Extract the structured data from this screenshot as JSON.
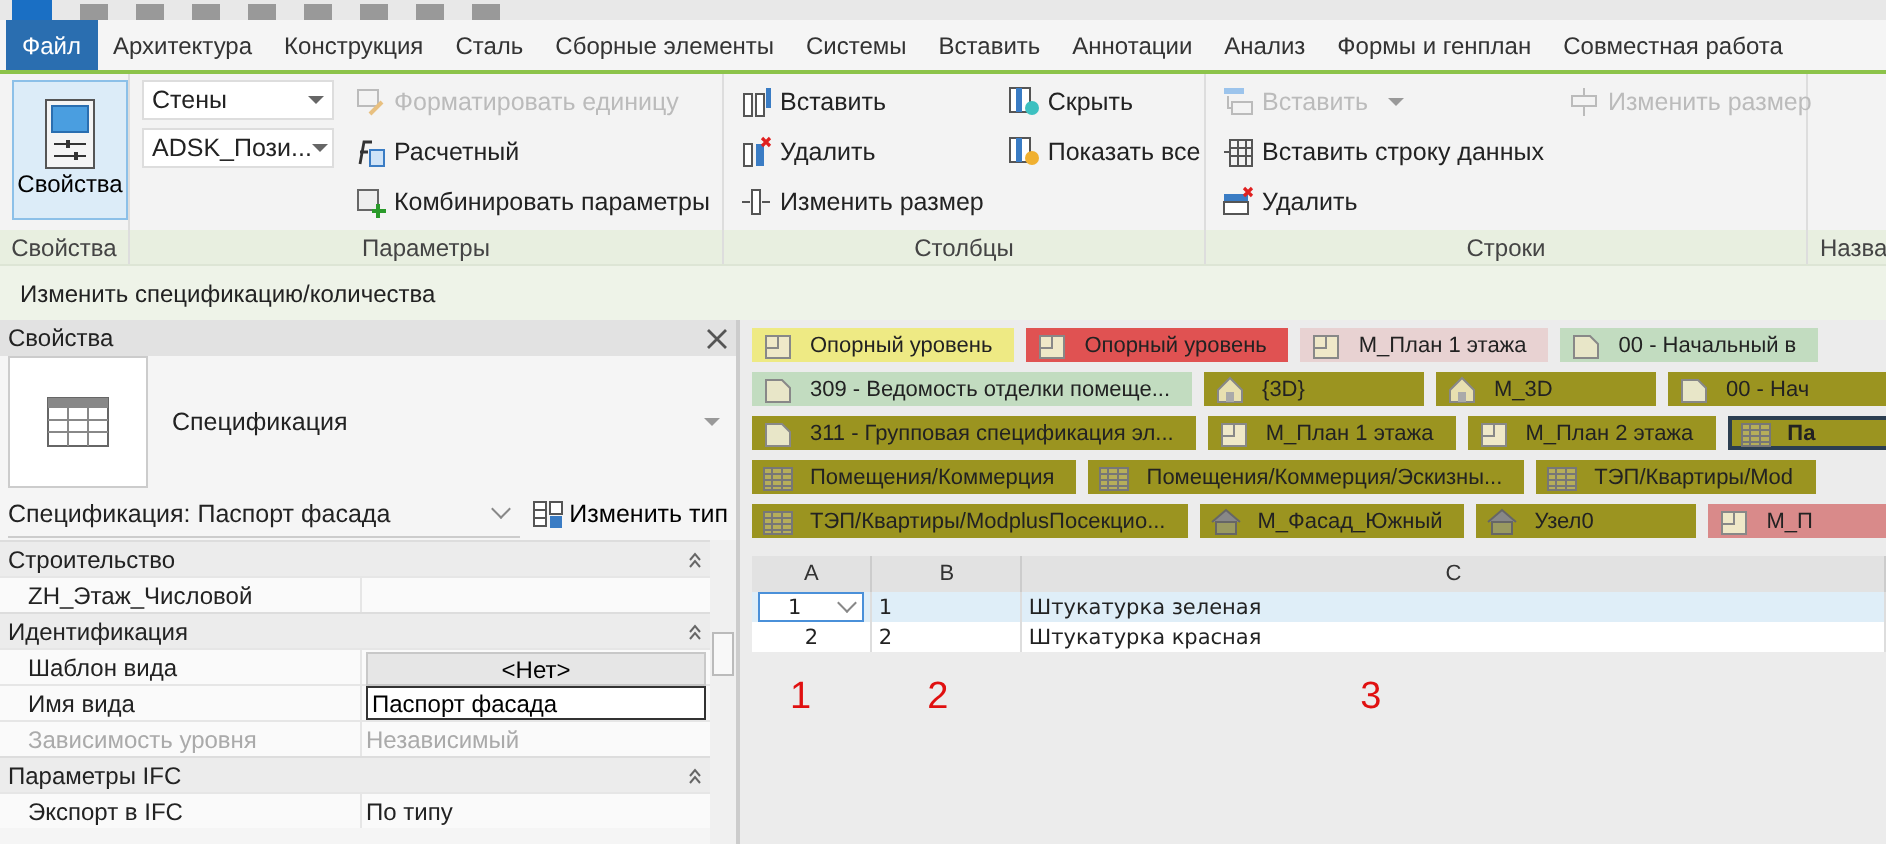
{
  "menu_tabs": [
    {
      "label": "Файл",
      "kind": "app-menu"
    },
    {
      "label": "Архитектура",
      "kind": "tab"
    },
    {
      "label": "Конструкция",
      "kind": "tab"
    },
    {
      "label": "Сталь",
      "kind": "tab"
    },
    {
      "label": "Сборные элементы",
      "kind": "tab"
    },
    {
      "label": "Системы",
      "kind": "tab"
    },
    {
      "label": "Вставить",
      "kind": "tab"
    },
    {
      "label": "Аннотации",
      "kind": "tab"
    },
    {
      "label": "Анализ",
      "kind": "tab"
    },
    {
      "label": "Формы и генплан",
      "kind": "tab"
    },
    {
      "label": "Совместная работа",
      "kind": "tab"
    }
  ],
  "ribbon": {
    "panels": [
      {
        "title": "Свойства",
        "kind": "large",
        "button": {
          "label": "Свойства",
          "selected": true
        }
      },
      {
        "title": "Параметры",
        "kind": "columns",
        "columns": [
          [
            {
              "kind": "dropdown",
              "value": "Стены"
            },
            {
              "kind": "dropdown",
              "value": "ADSK_Пози..."
            }
          ],
          [
            {
              "kind": "button",
              "label": "Форматировать единицу",
              "disabled": true
            },
            {
              "kind": "button",
              "label": "Расчетный",
              "disabled": false
            },
            {
              "kind": "button",
              "label": "Комбинировать параметры",
              "disabled": false
            }
          ]
        ]
      },
      {
        "title": "Столбцы",
        "kind": "columns",
        "columns": [
          [
            {
              "kind": "button",
              "label": "Вставить",
              "disabled": false
            },
            {
              "kind": "button",
              "label": "Удалить",
              "disabled": false
            },
            {
              "kind": "button",
              "label": "Изменить размер",
              "disabled": false
            }
          ],
          [
            {
              "kind": "button",
              "label": "Скрыть",
              "disabled": false
            },
            {
              "kind": "button",
              "label": "Показать  все",
              "disabled": false
            }
          ]
        ]
      },
      {
        "title": "Строки",
        "kind": "columns",
        "columns": [
          [
            {
              "kind": "split",
              "label": "Вставить",
              "disabled": true
            },
            {
              "kind": "button",
              "label": "Вставить  строку данных",
              "disabled": false
            },
            {
              "kind": "button",
              "label": "Удалить",
              "disabled": false
            }
          ],
          [
            {
              "kind": "button",
              "label": "Изменить размер",
              "disabled": true
            }
          ]
        ]
      },
      {
        "title": "Назва",
        "kind": "stub"
      }
    ]
  },
  "context_bar": {
    "label": "Изменить спецификацию/количества"
  },
  "properties": {
    "title": "Свойства",
    "type_name": "Спецификация",
    "instance": "Спецификация: Паспорт фасада",
    "edit_type": "Изменить тип",
    "groups": [
      {
        "title": "Строительство",
        "expanded": true,
        "rows": [
          {
            "name": "ZH_Этаж_Числовой",
            "kind": "empty",
            "disabled": false
          }
        ]
      },
      {
        "title": "Идентификация",
        "expanded": true,
        "rows": [
          {
            "name": "Шаблон вида",
            "kind": "button",
            "value": "<Нет>",
            "disabled": false
          },
          {
            "name": "Имя вида",
            "kind": "input",
            "value": "Паспорт фасада",
            "disabled": false
          },
          {
            "name": "Зависимость уровня",
            "kind": "text",
            "value": "Независимый",
            "disabled": true
          }
        ]
      },
      {
        "title": "Параметры IFC",
        "expanded": true,
        "rows": [
          {
            "name": "Экспорт в IFC",
            "kind": "text",
            "value": "По типу",
            "disabled": false
          }
        ]
      }
    ]
  },
  "view_tabs": [
    [
      {
        "label": "Опорный уровень",
        "kind": "plan",
        "color": "#eeea84",
        "selected": false
      },
      {
        "label": "Опорный уровень",
        "kind": "plan",
        "color": "#e05252",
        "selected": false
      },
      {
        "label": "М_План 1 этажа",
        "kind": "plan",
        "color": "#e8d2d2",
        "selected": false
      },
      {
        "label": "00 - Начальный в",
        "kind": "sheet",
        "color": "#c2dcc0",
        "selected": false
      }
    ],
    [
      {
        "label": "309 - Ведомость отделки помеще...",
        "kind": "sheet",
        "color": "#c2dcc0",
        "selected": false
      },
      {
        "label": "{3D}",
        "kind": "perspective",
        "color": "#9b9420",
        "selected": false
      },
      {
        "label": "М_3D",
        "kind": "perspective",
        "color": "#9b9420",
        "selected": false
      },
      {
        "label": "00 - Нач",
        "kind": "sheet",
        "color": "#9b9420",
        "selected": false
      }
    ],
    [
      {
        "label": "311 - Групповая спецификация эл...",
        "kind": "sheet",
        "color": "#9b9420",
        "selected": false
      },
      {
        "label": "М_План 1 этажа",
        "kind": "plan",
        "color": "#9b9420",
        "selected": false
      },
      {
        "label": "М_План 2 этажа",
        "kind": "plan",
        "color": "#9b9420",
        "selected": false
      },
      {
        "label": "Па",
        "kind": "schedule",
        "color": "#9b9420",
        "selected": true
      }
    ],
    [
      {
        "label": "Помещения/Коммерция",
        "kind": "schedule",
        "color": "#9b9420",
        "selected": false
      },
      {
        "label": "Помещения/Коммерция/Эскизны...",
        "kind": "schedule",
        "color": "#9b9420",
        "selected": false
      },
      {
        "label": "ТЭП/Квартиры/Mod",
        "kind": "schedule",
        "color": "#9b9420",
        "selected": false
      }
    ],
    [
      {
        "label": "ТЭП/Квартиры/ModplusПосекцио...",
        "kind": "schedule",
        "color": "#9b9420",
        "selected": false
      },
      {
        "label": "М_Фасад_Южный",
        "kind": "elevation",
        "color": "#9b9420",
        "selected": false
      },
      {
        "label": "Узел0",
        "kind": "elevation",
        "color": "#9b9420",
        "selected": false
      },
      {
        "label": "М_П",
        "kind": "plan",
        "color": "#d98a8a",
        "selected": false
      }
    ]
  ],
  "schedule": {
    "columns": [
      "A",
      "B",
      "C"
    ],
    "rows": [
      {
        "cells": [
          "1",
          "1",
          "Штукатурка зеленая"
        ],
        "selected": true
      },
      {
        "cells": [
          "2",
          "2",
          "Штукатурка красная"
        ],
        "selected": false
      }
    ]
  },
  "column_markers": [
    "1",
    "2",
    "3"
  ]
}
